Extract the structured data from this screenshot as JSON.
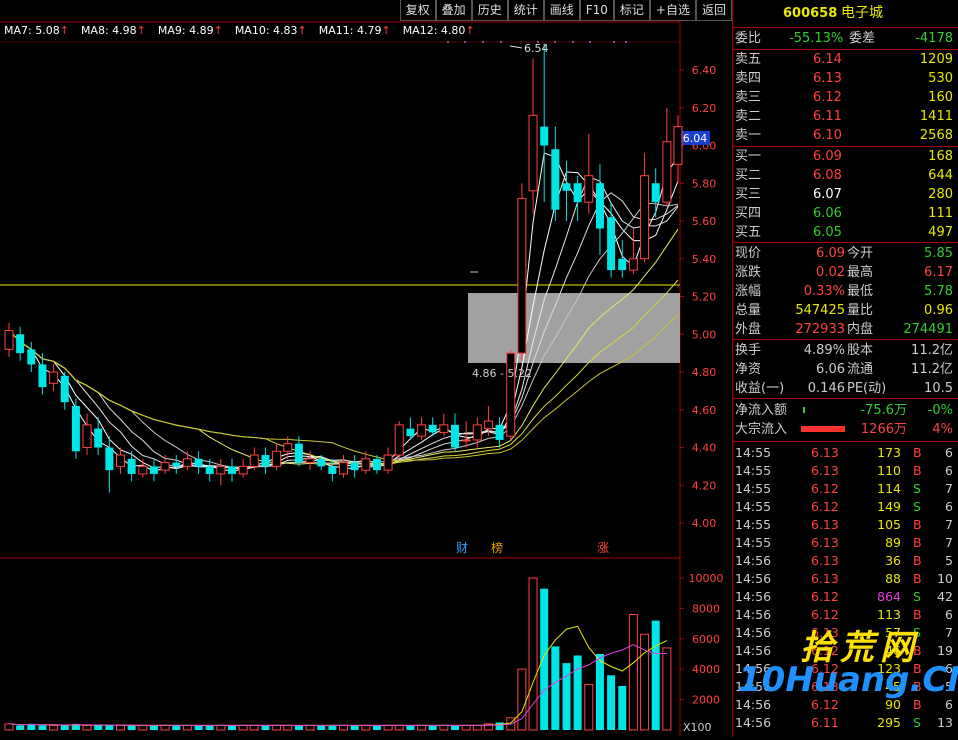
{
  "toolbar": [
    {
      "key": "fuquan",
      "label": "复权"
    },
    {
      "key": "diejia",
      "label": "叠加"
    },
    {
      "key": "lishi",
      "label": "历史"
    },
    {
      "key": "tongji",
      "label": "统计"
    },
    {
      "key": "huaxian",
      "label": "画线"
    },
    {
      "key": "f10",
      "label": "F10"
    },
    {
      "key": "biaoji",
      "label": "标记"
    },
    {
      "key": "zixuan",
      "label": "+自选"
    },
    {
      "key": "fanhui",
      "label": "返回"
    }
  ],
  "ma_legend": [
    {
      "label": "MA7: 5.08",
      "color": "#ffffff"
    },
    {
      "label": "MA8: 4.98",
      "color": "#ffffff"
    },
    {
      "label": "MA9: 4.89",
      "color": "#ffffff"
    },
    {
      "label": "MA10: 4.83",
      "color": "#ffffff"
    },
    {
      "label": "MA11: 4.79",
      "color": "#ffffff"
    },
    {
      "label": "MA12: 4.80",
      "color": "#ffffff"
    }
  ],
  "chart_data": {
    "type": "candlestick",
    "price_axis": {
      "ticks": [
        "6.40",
        "6.20",
        "6.00",
        "5.80",
        "5.60",
        "5.40",
        "5.20",
        "5.00",
        "4.80",
        "4.60",
        "4.40",
        "4.20",
        "4.00"
      ],
      "range": [
        3.9,
        6.6
      ],
      "current": "6.04"
    },
    "volume_axis": {
      "ticks": [
        "10000",
        "8000",
        "6000",
        "4000",
        "2000"
      ],
      "unit": "X100"
    },
    "annotations": {
      "high": "6.54",
      "low": "4.86 - 5.22",
      "markers": [
        "财",
        "榜",
        "涨"
      ]
    },
    "candles": [
      [
        4.92,
        5.02,
        5.06,
        4.88
      ],
      [
        5.0,
        4.9,
        5.04,
        4.86
      ],
      [
        4.92,
        4.84,
        4.96,
        4.8
      ],
      [
        4.84,
        4.72,
        4.9,
        4.68
      ],
      [
        4.74,
        4.8,
        4.84,
        4.7
      ],
      [
        4.78,
        4.64,
        4.8,
        4.6
      ],
      [
        4.62,
        4.38,
        4.66,
        4.34
      ],
      [
        4.4,
        4.52,
        4.58,
        4.36
      ],
      [
        4.5,
        4.4,
        4.56,
        4.36
      ],
      [
        4.4,
        4.28,
        4.46,
        4.16
      ],
      [
        4.3,
        4.36,
        4.4,
        4.26
      ],
      [
        4.34,
        4.26,
        4.38,
        4.22
      ],
      [
        4.26,
        4.3,
        4.34,
        4.24
      ],
      [
        4.3,
        4.26,
        4.34,
        4.22
      ],
      [
        4.28,
        4.32,
        4.36,
        4.26
      ],
      [
        4.32,
        4.3,
        4.36,
        4.26
      ],
      [
        4.3,
        4.34,
        4.38,
        4.28
      ],
      [
        4.34,
        4.3,
        4.38,
        4.26
      ],
      [
        4.3,
        4.26,
        4.34,
        4.22
      ],
      [
        4.26,
        4.3,
        4.34,
        4.2
      ],
      [
        4.3,
        4.26,
        4.34,
        4.22
      ],
      [
        4.26,
        4.3,
        4.34,
        4.24
      ],
      [
        4.3,
        4.36,
        4.4,
        4.28
      ],
      [
        4.36,
        4.3,
        4.4,
        4.26
      ],
      [
        4.3,
        4.38,
        4.42,
        4.28
      ],
      [
        4.38,
        4.42,
        4.46,
        4.34
      ],
      [
        4.42,
        4.32,
        4.46,
        4.3
      ],
      [
        4.32,
        4.34,
        4.38,
        4.28
      ],
      [
        4.34,
        4.3,
        4.36,
        4.28
      ],
      [
        4.3,
        4.26,
        4.34,
        4.22
      ],
      [
        4.26,
        4.32,
        4.36,
        4.24
      ],
      [
        4.32,
        4.28,
        4.36,
        4.24
      ],
      [
        4.28,
        4.34,
        4.38,
        4.26
      ],
      [
        4.34,
        4.28,
        4.36,
        4.26
      ],
      [
        4.28,
        4.36,
        4.4,
        4.26
      ],
      [
        4.36,
        4.52,
        4.54,
        4.34
      ],
      [
        4.5,
        4.46,
        4.56,
        4.44
      ],
      [
        4.46,
        4.52,
        4.56,
        4.44
      ],
      [
        4.52,
        4.48,
        4.56,
        4.46
      ],
      [
        4.48,
        4.52,
        4.58,
        4.46
      ],
      [
        4.52,
        4.4,
        4.58,
        4.38
      ],
      [
        4.44,
        4.44,
        4.54,
        4.4
      ],
      [
        4.44,
        4.52,
        4.56,
        4.4
      ],
      [
        4.5,
        4.54,
        4.62,
        4.46
      ],
      [
        4.52,
        4.44,
        4.56,
        4.4
      ],
      [
        4.46,
        4.9,
        4.92,
        4.44
      ],
      [
        4.9,
        5.72,
        5.8,
        4.86
      ],
      [
        5.76,
        6.16,
        6.46,
        5.64
      ],
      [
        6.1,
        6.0,
        6.54,
        5.7
      ],
      [
        5.98,
        5.66,
        6.1,
        5.6
      ],
      [
        5.8,
        5.76,
        5.92,
        5.6
      ],
      [
        5.8,
        5.7,
        5.84,
        5.6
      ],
      [
        5.7,
        5.84,
        6.06,
        5.64
      ],
      [
        5.8,
        5.56,
        5.9,
        5.42
      ],
      [
        5.62,
        5.34,
        5.7,
        5.3
      ],
      [
        5.4,
        5.34,
        5.5,
        5.3
      ],
      [
        5.34,
        5.4,
        5.56,
        5.32
      ],
      [
        5.4,
        5.84,
        5.96,
        5.38
      ],
      [
        5.8,
        5.7,
        5.88,
        5.62
      ],
      [
        5.7,
        6.02,
        6.2,
        5.68
      ],
      [
        5.9,
        6.1,
        6.16,
        5.8
      ]
    ],
    "candle_x": {
      "first": 9,
      "step": 11.15
    },
    "volumes": [
      4,
      3,
      4,
      3,
      3,
      3,
      4,
      3,
      3,
      3,
      3,
      3,
      3,
      3,
      3,
      3,
      3,
      3,
      3,
      3,
      3,
      3,
      3,
      3,
      3,
      3,
      3,
      3,
      3,
      3,
      3,
      3,
      3,
      3,
      3,
      3,
      3,
      3,
      3,
      3,
      3,
      3,
      3,
      4,
      5,
      8,
      40,
      100,
      93,
      55,
      44,
      49,
      30,
      50,
      36,
      29,
      76,
      63,
      72,
      54
    ],
    "volume_colors": [
      "#ff4040",
      "#00e5e5"
    ]
  },
  "quote": {
    "code": "600658",
    "name": "电子城",
    "weibi_label": "委比",
    "weibi": "-55.13%",
    "weicha_label": "委差",
    "weicha": "-4178",
    "sells": [
      {
        "label": "卖五",
        "price": "6.14",
        "vol": "1209"
      },
      {
        "label": "卖四",
        "price": "6.13",
        "vol": "530"
      },
      {
        "label": "卖三",
        "price": "6.12",
        "vol": "160"
      },
      {
        "label": "卖二",
        "price": "6.11",
        "vol": "1411"
      },
      {
        "label": "卖一",
        "price": "6.10",
        "vol": "2568"
      }
    ],
    "buys": [
      {
        "label": "买一",
        "price": "6.09",
        "vol": "168",
        "cls": "red"
      },
      {
        "label": "买二",
        "price": "6.08",
        "vol": "644",
        "cls": "red"
      },
      {
        "label": "买三",
        "price": "6.07",
        "vol": "280",
        "cls": "white"
      },
      {
        "label": "买四",
        "price": "6.06",
        "vol": "111",
        "cls": "green"
      },
      {
        "label": "买五",
        "price": "6.05",
        "vol": "497",
        "cls": "green"
      }
    ],
    "stats": [
      {
        "l1": "现价",
        "v1": "6.09",
        "c1": "red",
        "l2": "今开",
        "v2": "5.85",
        "c2": "green"
      },
      {
        "l1": "涨跌",
        "v1": "0.02",
        "c1": "red",
        "l2": "最高",
        "v2": "6.17",
        "c2": "red"
      },
      {
        "l1": "涨幅",
        "v1": "0.33%",
        "c1": "red",
        "l2": "最低",
        "v2": "5.78",
        "c2": "green"
      },
      {
        "l1": "总量",
        "v1": "547425",
        "c1": "yellow",
        "l2": "量比",
        "v2": "0.96",
        "c2": "yellow"
      },
      {
        "l1": "外盘",
        "v1": "272933",
        "c1": "red",
        "l2": "内盘",
        "v2": "274491",
        "c2": "green"
      }
    ],
    "stats2": [
      {
        "l1": "换手",
        "v1": "4.89%",
        "c1": "gray",
        "l2": "股本",
        "v2": "11.2亿",
        "c2": "gray"
      },
      {
        "l1": "净资",
        "v1": "6.06",
        "c1": "gray",
        "l2": "流通",
        "v2": "11.2亿",
        "c2": "gray"
      },
      {
        "l1": "收益(一)",
        "v1": "0.146",
        "c1": "gray",
        "l2": "PE(动)",
        "v2": "10.5",
        "c2": "gray"
      }
    ],
    "flow": [
      {
        "label": "净流入额",
        "value": "-75.6万",
        "pct": "-0%",
        "cls": "green"
      },
      {
        "label": "大宗流入",
        "value": "1266万",
        "pct": "4%",
        "cls": "red"
      }
    ]
  },
  "ticks": [
    {
      "t": "14:55",
      "p": "6.13",
      "v": "173",
      "s": "B",
      "n": "6",
      "vc": "yellow"
    },
    {
      "t": "14:55",
      "p": "6.13",
      "v": "110",
      "s": "B",
      "n": "6",
      "vc": "yellow"
    },
    {
      "t": "14:55",
      "p": "6.12",
      "v": "114",
      "s": "S",
      "n": "7",
      "vc": "yellow"
    },
    {
      "t": "14:55",
      "p": "6.12",
      "v": "149",
      "s": "S",
      "n": "6",
      "vc": "yellow"
    },
    {
      "t": "14:55",
      "p": "6.13",
      "v": "105",
      "s": "B",
      "n": "7",
      "vc": "yellow"
    },
    {
      "t": "14:55",
      "p": "6.13",
      "v": "89",
      "s": "B",
      "n": "7",
      "vc": "yellow"
    },
    {
      "t": "14:56",
      "p": "6.13",
      "v": "36",
      "s": "B",
      "n": "5",
      "vc": "yellow"
    },
    {
      "t": "14:56",
      "p": "6.13",
      "v": "88",
      "s": "B",
      "n": "10",
      "vc": "yellow"
    },
    {
      "t": "14:56",
      "p": "6.12",
      "v": "864",
      "s": "S",
      "n": "42",
      "vc": "mag"
    },
    {
      "t": "14:56",
      "p": "6.12",
      "v": "113",
      "s": "B",
      "n": "6",
      "vc": "yellow"
    },
    {
      "t": "14:56",
      "p": "6.13",
      "v": "57",
      "s": "S",
      "n": "7",
      "vc": "yellow"
    },
    {
      "t": "14:56",
      "p": "6.12",
      "v": "46",
      "s": "B",
      "n": "19",
      "vc": "yellow"
    },
    {
      "t": "14:56",
      "p": "6.12",
      "v": "123",
      "s": "B",
      "n": "6",
      "vc": "yellow"
    },
    {
      "t": "14:56",
      "p": "6.13",
      "v": "45",
      "s": "B",
      "n": "5",
      "vc": "yellow"
    },
    {
      "t": "14:56",
      "p": "6.12",
      "v": "90",
      "s": "B",
      "n": "6",
      "vc": "yellow"
    },
    {
      "t": "14:56",
      "p": "6.11",
      "v": "295",
      "s": "S",
      "n": "13",
      "vc": "yellow"
    }
  ],
  "watermark": {
    "line1": "拾荒网",
    "line2": "10Huang.CN"
  }
}
